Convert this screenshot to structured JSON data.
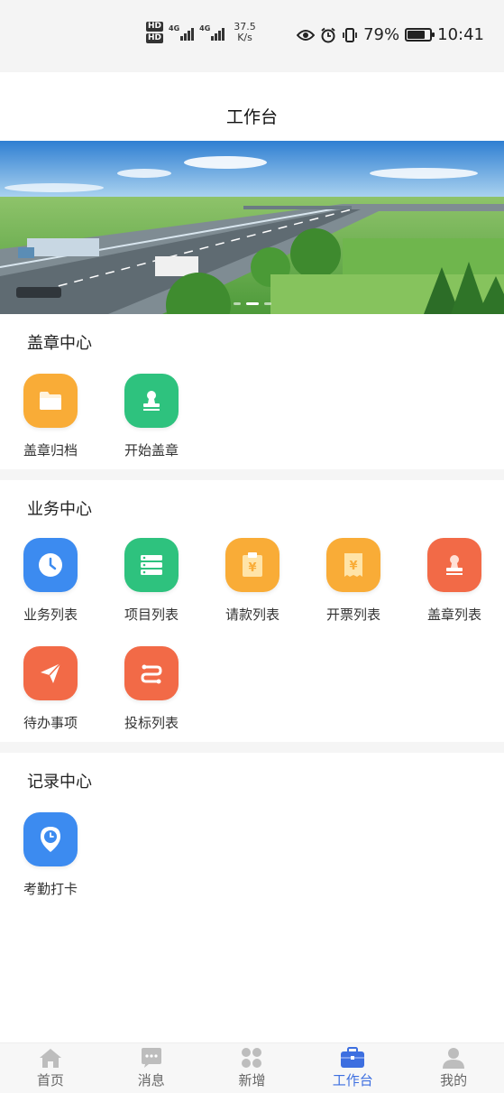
{
  "status_bar": {
    "hd1": "HD",
    "hd2": "HD",
    "net1": "4G",
    "net2": "4G",
    "speed_value": "37.5",
    "speed_unit": "K/s",
    "battery": "79%",
    "battery_level": 0.79,
    "time": "10:41"
  },
  "header": {
    "title": "工作台"
  },
  "banner": {
    "slide_count": 3,
    "active_slide": 1
  },
  "sections": [
    {
      "title": "盖章中心",
      "items": [
        {
          "label": "盖章归档",
          "icon": "folder-icon",
          "color": "#f9ac37"
        },
        {
          "label": "开始盖章",
          "icon": "stamp-icon",
          "color": "#2ec27e"
        }
      ]
    },
    {
      "title": "业务中心",
      "items": [
        {
          "label": "业务列表",
          "icon": "clock-icon",
          "color": "#3c8bf0"
        },
        {
          "label": "项目列表",
          "icon": "list-icon",
          "color": "#2ec27e"
        },
        {
          "label": "请款列表",
          "icon": "clipboard-yen-icon",
          "color": "#f9ac37"
        },
        {
          "label": "开票列表",
          "icon": "invoice-yen-icon",
          "color": "#f9ac37"
        },
        {
          "label": "盖章列表",
          "icon": "stamp-icon",
          "color": "#f26a47"
        },
        {
          "label": "待办事项",
          "icon": "paper-plane-icon",
          "color": "#f26a47"
        },
        {
          "label": "投标列表",
          "icon": "route-icon",
          "color": "#f26a47"
        }
      ]
    },
    {
      "title": "记录中心",
      "items": [
        {
          "label": "考勤打卡",
          "icon": "location-clock-icon",
          "color": "#3c8bf0"
        }
      ]
    }
  ],
  "tabbar": {
    "tabs": [
      {
        "label": "首页",
        "icon": "home-icon"
      },
      {
        "label": "消息",
        "icon": "message-icon"
      },
      {
        "label": "新增",
        "icon": "grid-icon"
      },
      {
        "label": "工作台",
        "icon": "briefcase-icon",
        "active": true
      },
      {
        "label": "我的",
        "icon": "user-icon"
      }
    ],
    "active_color": "#3d6fe0",
    "inactive_color": "#b8b8b8"
  }
}
